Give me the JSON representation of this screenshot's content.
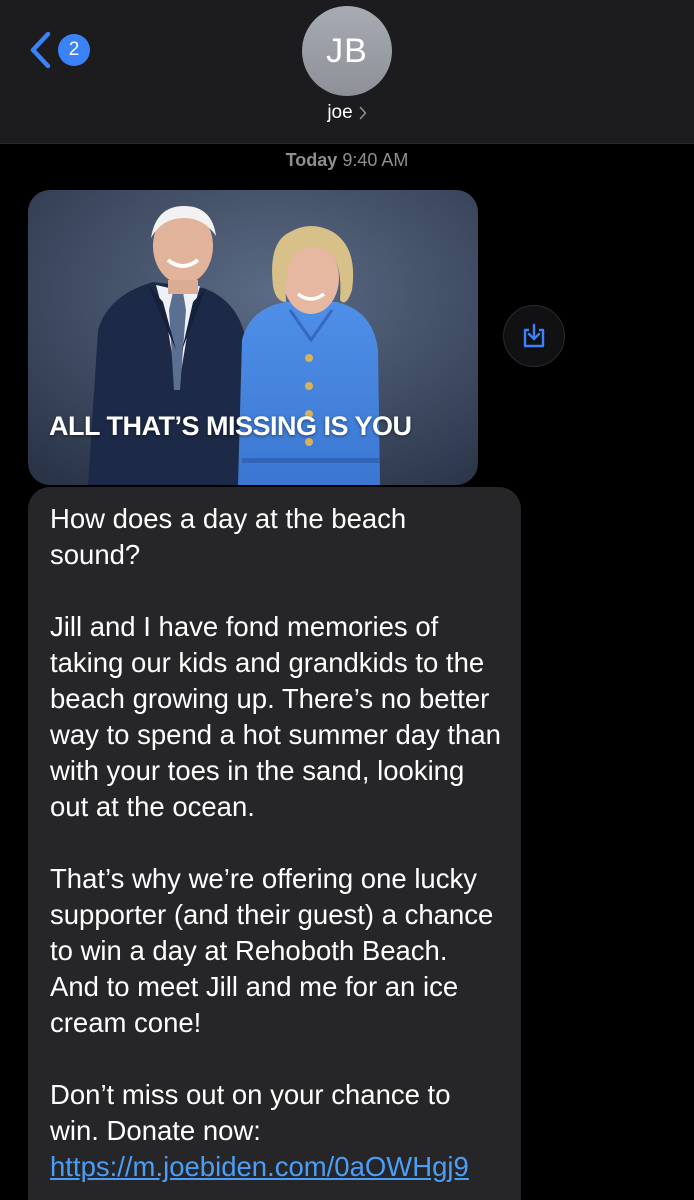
{
  "header": {
    "back_badge_count": "2",
    "avatar_initials": "JB",
    "contact_name": "joe"
  },
  "thread": {
    "timestamp_day": "Today",
    "timestamp_time": "9:40 AM",
    "image_caption": "ALL THAT’S MISSING IS YOU",
    "message": {
      "p1": "How does a day at the beach sound?",
      "p2": "Jill and I have fond memories of taking our kids and grandkids to the beach growing up. There’s no better way to spend a hot summer day than with your toes in the sand, looking out at the ocean.",
      "p3": "That’s why we’re offering one lucky supporter (and their guest) a chance to win a day at Rehoboth Beach. And to meet Jill and me for an ice cream cone!",
      "p4_text": "Don’t miss out on your chance to win. Donate now:",
      "p4_link": "https://m.joebiden.com/0aOWHgj9"
    }
  },
  "icons": {
    "back": "chevron-left-icon",
    "contact_chevron": "chevron-right-icon",
    "save": "save-download-icon"
  },
  "colors": {
    "accent": "#3a82f7",
    "link": "#4b9ef7",
    "bubble": "#262628",
    "header_bg": "#1c1c1e"
  }
}
